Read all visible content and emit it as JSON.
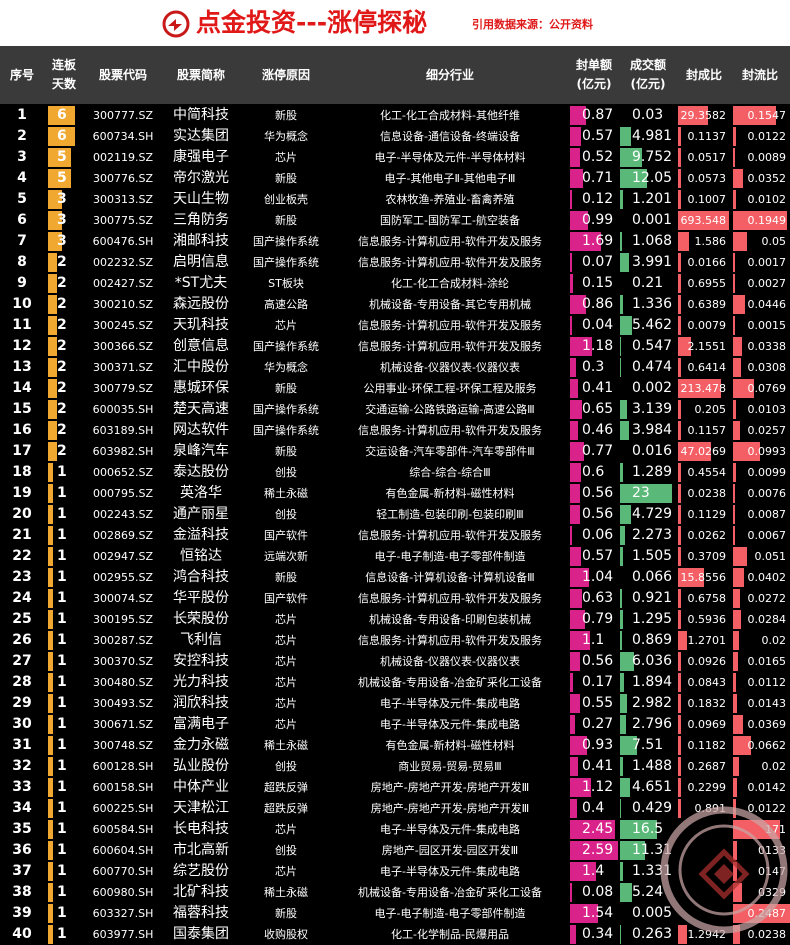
{
  "header": {
    "title": "点金投资---涨停探秘",
    "source": "引用数据来源：公开资料"
  },
  "columns": {
    "idx": "序号",
    "days": "连板\n天数",
    "code": "股票代码",
    "name": "股票简称",
    "reason": "涨停原因",
    "industry": "细分行业",
    "seal": "封单额\n(亿元)",
    "vol": "成交额\n(亿元)",
    "ratio": "封成比",
    "flow": "封流比"
  },
  "colors": {
    "days": "#f0a830",
    "seal": "#d9238a",
    "vol": "#5ab879",
    "ratio": "#f45f65",
    "header_red": "#e01818"
  },
  "rows": [
    [
      "1",
      "6",
      "300777.SZ",
      "中简科技",
      "新股",
      "化工-化工合成材料-其他纤维",
      "0.87",
      "0.03",
      "29.3582",
      "0.1547"
    ],
    [
      "2",
      "6",
      "600734.SH",
      "实达集团",
      "华为概念",
      "信息设备-通信设备-终端设备",
      "0.57",
      "4.981",
      "0.1137",
      "0.0122"
    ],
    [
      "3",
      "5",
      "002119.SZ",
      "康强电子",
      "芯片",
      "电子-半导体及元件-半导体材料",
      "0.52",
      "9.752",
      "0.0517",
      "0.0089"
    ],
    [
      "4",
      "5",
      "300776.SZ",
      "帝尔激光",
      "新股",
      "电子-其他电子Ⅱ-其他电子Ⅲ",
      "0.71",
      "12.05",
      "0.0573",
      "0.0352"
    ],
    [
      "5",
      "3",
      "300313.SZ",
      "天山生物",
      "创业板壳",
      "农林牧渔-养殖业-畜禽养殖",
      "0.12",
      "1.201",
      "0.1007",
      "0.0102"
    ],
    [
      "6",
      "3",
      "300775.SZ",
      "三角防务",
      "新股",
      "国防军工-国防军工-航空装备",
      "0.99",
      "0.001",
      "693.548",
      "0.1949"
    ],
    [
      "7",
      "3",
      "600476.SH",
      "湘邮科技",
      "国产操作系统",
      "信息服务-计算机应用-软件开发及服务",
      "1.69",
      "1.068",
      "1.586",
      "0.05"
    ],
    [
      "8",
      "2",
      "002232.SZ",
      "启明信息",
      "国产操作系统",
      "信息服务-计算机应用-软件开发及服务",
      "0.07",
      "3.991",
      "0.0166",
      "0.0017"
    ],
    [
      "9",
      "2",
      "002427.SZ",
      "*ST尤夫",
      "ST板块",
      "化工-化工合成材料-涂纶",
      "0.15",
      "0.21",
      "0.6955",
      "0.0027"
    ],
    [
      "10",
      "2",
      "300210.SZ",
      "森远股份",
      "高速公路",
      "机械设备-专用设备-其它专用机械",
      "0.86",
      "1.336",
      "0.6389",
      "0.0446"
    ],
    [
      "11",
      "2",
      "300245.SZ",
      "天玑科技",
      "芯片",
      "信息服务-计算机应用-软件开发及服务",
      "0.04",
      "5.462",
      "0.0079",
      "0.0015"
    ],
    [
      "12",
      "2",
      "300366.SZ",
      "创意信息",
      "国产操作系统",
      "信息服务-计算机应用-软件开发及服务",
      "1.18",
      "0.547",
      "2.1551",
      "0.0338"
    ],
    [
      "13",
      "2",
      "300371.SZ",
      "汇中股份",
      "华为概念",
      "机械设备-仪器仪表-仪器仪表",
      "0.3",
      "0.474",
      "0.6414",
      "0.0308"
    ],
    [
      "14",
      "2",
      "300779.SZ",
      "惠城环保",
      "新股",
      "公用事业-环保工程-环保工程及服务",
      "0.41",
      "0.002",
      "213.478",
      "0.0769"
    ],
    [
      "15",
      "2",
      "600035.SH",
      "楚天高速",
      "国产操作系统",
      "交通运输-公路铁路运输-高速公路Ⅲ",
      "0.65",
      "3.139",
      "0.205",
      "0.0103"
    ],
    [
      "16",
      "2",
      "603189.SH",
      "网达软件",
      "国产操作系统",
      "信息服务-计算机应用-软件开发及服务",
      "0.46",
      "3.984",
      "0.1157",
      "0.0257"
    ],
    [
      "17",
      "2",
      "603982.SH",
      "泉峰汽车",
      "新股",
      "交运设备-汽车零部件-汽车零部件Ⅲ",
      "0.77",
      "0.016",
      "47.0269",
      "0.0993"
    ],
    [
      "18",
      "1",
      "000652.SZ",
      "泰达股份",
      "创投",
      "综合-综合-综合Ⅲ",
      "0.6",
      "1.289",
      "0.4554",
      "0.0099"
    ],
    [
      "19",
      "1",
      "000795.SZ",
      "英洛华",
      "稀土永磁",
      "有色金属-新材料-磁性材料",
      "0.56",
      "23",
      "0.0238",
      "0.0076"
    ],
    [
      "20",
      "1",
      "002243.SZ",
      "通产丽星",
      "创投",
      "轻工制造-包装印刷-包装印刷Ⅲ",
      "0.56",
      "4.729",
      "0.1129",
      "0.0087"
    ],
    [
      "21",
      "1",
      "002869.SZ",
      "金溢科技",
      "国产软件",
      "信息服务-计算机应用-软件开发及服务",
      "0.06",
      "2.273",
      "0.0262",
      "0.0067"
    ],
    [
      "22",
      "1",
      "002947.SZ",
      "恒铭达",
      "远端次新",
      "电子-电子制造-电子零部件制造",
      "0.57",
      "1.505",
      "0.3709",
      "0.051"
    ],
    [
      "23",
      "1",
      "002955.SZ",
      "鸿合科技",
      "新股",
      "信息设备-计算机设备-计算机设备Ⅲ",
      "1.04",
      "0.066",
      "15.8556",
      "0.0402"
    ],
    [
      "24",
      "1",
      "300074.SZ",
      "华平股份",
      "国产软件",
      "信息服务-计算机应用-软件开发及服务",
      "0.63",
      "0.921",
      "0.6758",
      "0.0272"
    ],
    [
      "25",
      "1",
      "300195.SZ",
      "长荣股份",
      "芯片",
      "机械设备-专用设备-印刷包装机械",
      "0.79",
      "1.295",
      "0.5936",
      "0.0284"
    ],
    [
      "26",
      "1",
      "300287.SZ",
      "飞利信",
      "芯片",
      "信息服务-计算机应用-软件开发及服务",
      "1.1",
      "0.869",
      "1.2701",
      "0.02"
    ],
    [
      "27",
      "1",
      "300370.SZ",
      "安控科技",
      "芯片",
      "机械设备-仪器仪表-仪器仪表",
      "0.56",
      "6.036",
      "0.0926",
      "0.0165"
    ],
    [
      "28",
      "1",
      "300480.SZ",
      "光力科技",
      "芯片",
      "机械设备-专用设备-冶金矿采化工设备",
      "0.17",
      "1.894",
      "0.0843",
      "0.0112"
    ],
    [
      "29",
      "1",
      "300493.SZ",
      "润欣科技",
      "芯片",
      "电子-半导体及元件-集成电路",
      "0.55",
      "2.982",
      "0.1832",
      "0.0143"
    ],
    [
      "30",
      "1",
      "300671.SZ",
      "富满电子",
      "芯片",
      "电子-半导体及元件-集成电路",
      "0.27",
      "2.796",
      "0.0969",
      "0.0369"
    ],
    [
      "31",
      "1",
      "300748.SZ",
      "金力永磁",
      "稀土永磁",
      "有色金属-新材料-磁性材料",
      "0.93",
      "7.51",
      "0.1182",
      "0.0662"
    ],
    [
      "32",
      "1",
      "600128.SH",
      "弘业股份",
      "创投",
      "商业贸易-贸易-贸易Ⅲ",
      "0.41",
      "1.488",
      "0.2687",
      "0.02"
    ],
    [
      "33",
      "1",
      "600158.SH",
      "中体产业",
      "超跌反弹",
      "房地产-房地产开发-房地产开发Ⅲ",
      "1.12",
      "4.651",
      "0.2299",
      "0.0142"
    ],
    [
      "34",
      "1",
      "600225.SH",
      "天津松江",
      "超跌反弹",
      "房地产-房地产开发-房地产开发Ⅲ",
      "0.4",
      "0.429",
      "0.891",
      "0.0122"
    ],
    [
      "35",
      "1",
      "600584.SH",
      "长电科技",
      "芯片",
      "电子-半导体及元件-集成电路",
      "2.45",
      "16.5",
      "",
      "171"
    ],
    [
      "36",
      "1",
      "600604.SH",
      "市北高新",
      "创投",
      "房地产-园区开发-园区开发Ⅲ",
      "2.59",
      "11.31",
      "",
      "0133"
    ],
    [
      "37",
      "1",
      "600770.SH",
      "综艺股份",
      "芯片",
      "电子-半导体及元件-集成电路",
      "1.4",
      "1.331",
      "",
      "0147"
    ],
    [
      "38",
      "1",
      "600980.SH",
      "北矿科技",
      "稀土永磁",
      "机械设备-专用设备-冶金矿采化工设备",
      "0.08",
      "5.24",
      "",
      "0329"
    ],
    [
      "39",
      "1",
      "603327.SH",
      "福蓉科技",
      "新股",
      "电子-电子制造-电子零部件制造",
      "1.54",
      "0.005",
      "",
      "0.2487"
    ],
    [
      "40",
      "1",
      "603977.SH",
      "国泰集团",
      "收购股权",
      "化工-化学制品-民爆用品",
      "0.34",
      "0.263",
      "1.2942",
      "0.0238"
    ]
  ]
}
